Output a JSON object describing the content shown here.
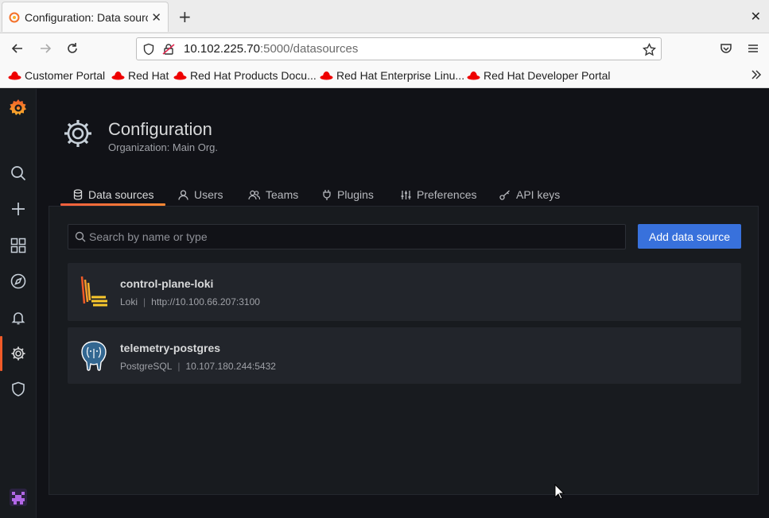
{
  "browser": {
    "tab_title": "Configuration: Data sources",
    "new_tab": "+",
    "close": "✕",
    "url_host": "10.102.225.70",
    "url_path": ":5000/datasources",
    "bookmarks": [
      {
        "label": "Customer Portal"
      },
      {
        "label": "Red Hat"
      },
      {
        "label": "Red Hat Products Docu..."
      },
      {
        "label": "Red Hat Enterprise Linu..."
      },
      {
        "label": "Red Hat Developer Portal"
      }
    ]
  },
  "page": {
    "title": "Configuration",
    "subtitle": "Organization: Main Org."
  },
  "tabs": [
    {
      "label": "Data sources",
      "icon": "database-icon",
      "active": true
    },
    {
      "label": "Users",
      "icon": "user-icon"
    },
    {
      "label": "Teams",
      "icon": "users-icon"
    },
    {
      "label": "Plugins",
      "icon": "plug-icon"
    },
    {
      "label": "Preferences",
      "icon": "sliders-icon"
    },
    {
      "label": "API keys",
      "icon": "key-icon"
    }
  ],
  "search": {
    "placeholder": "Search by name or type",
    "value": ""
  },
  "add_button": "Add data source",
  "datasources": [
    {
      "name": "control-plane-loki",
      "type": "Loki",
      "separator": "|",
      "url": "http://10.100.66.207:3100",
      "icon": "loki-logo-icon"
    },
    {
      "name": "telemetry-postgres",
      "type": "PostgreSQL",
      "separator": "|",
      "url": "10.107.180.244:5432",
      "icon": "postgres-logo-icon"
    }
  ],
  "colors": {
    "accent": "#f05a28",
    "primary_button": "#3871dc",
    "background": "#111217",
    "panel": "#181b1f",
    "card": "#22252b"
  }
}
